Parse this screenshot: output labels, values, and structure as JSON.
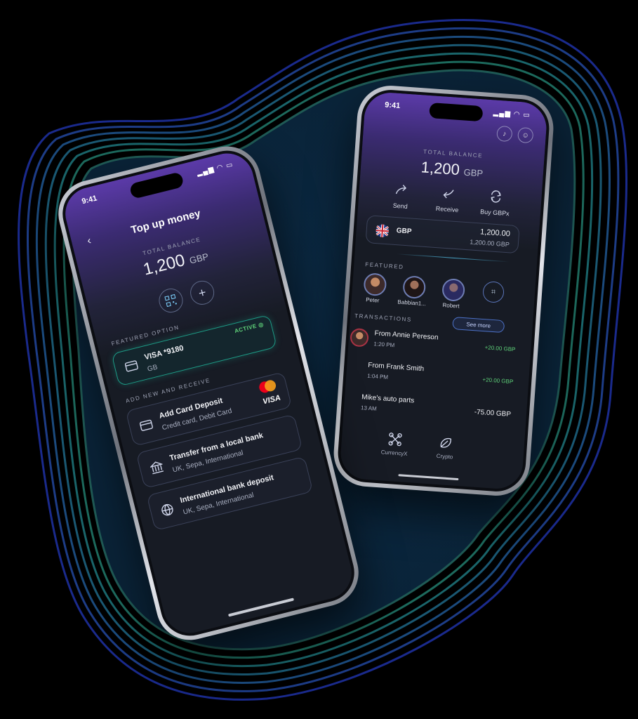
{
  "colors": {
    "background": "#000000",
    "accent_purple": "#5b3aa8",
    "active_green": "#5fd37a",
    "screen": "#171b24"
  },
  "back_phone": {
    "status_time": "9:41",
    "total_balance_label": "TOTAL BALANCE",
    "balance_amount": "1,200",
    "balance_currency": "GBP",
    "actions": [
      {
        "label": "Send",
        "icon": "send-icon"
      },
      {
        "label": "Receive",
        "icon": "receive-icon"
      },
      {
        "label": "Buy GBPx",
        "icon": "exchange-icon"
      }
    ],
    "account": {
      "currency": "GBP",
      "amount": "1,200.00",
      "sub_amount": "1,200.00 GBP",
      "flag_icon": "uk-flag-icon"
    },
    "featured_label": "FEATURED",
    "featured": [
      "Peter",
      "Babbian1...",
      "Robert"
    ],
    "transactions_label": "TRANSACTIONS",
    "see_more": "See more",
    "transactions": [
      {
        "title": "From Annie Pereson",
        "time": "1:20 PM",
        "amount": "+20.00 GBP"
      },
      {
        "title": "From Frank Smith",
        "time": "1:04 PM",
        "amount": "+20.00 GBP"
      },
      {
        "title": "Mike's auto parts",
        "time": "13 AM",
        "amount": "-75.00 GBP"
      }
    ],
    "nav": [
      {
        "label": "CurrencyX"
      },
      {
        "label": "Crypto"
      }
    ]
  },
  "front_phone": {
    "status_time": "9:41",
    "title": "Top up money",
    "total_balance_label": "TOTAL BALANCE",
    "balance_amount": "1,200",
    "balance_currency": "GBP",
    "featured_option_label": "FEATURED OPTION",
    "active_badge": "ACTIVE",
    "featured_card": {
      "name": "VISA *9180",
      "sub": "GB"
    },
    "add_new_label": "ADD NEW AND RECEIVE",
    "options": [
      {
        "title": "Add Card Deposit",
        "sub": "Credit card, Debit Card",
        "icon": "card-icon"
      },
      {
        "title": "Transfer from a local bank",
        "sub": "UK, Sepa, International",
        "icon": "bank-icon"
      },
      {
        "title": "International bank deposit",
        "sub": "UK, Sepa, International",
        "icon": "globe-icon"
      }
    ],
    "visa_text": "VISA"
  }
}
